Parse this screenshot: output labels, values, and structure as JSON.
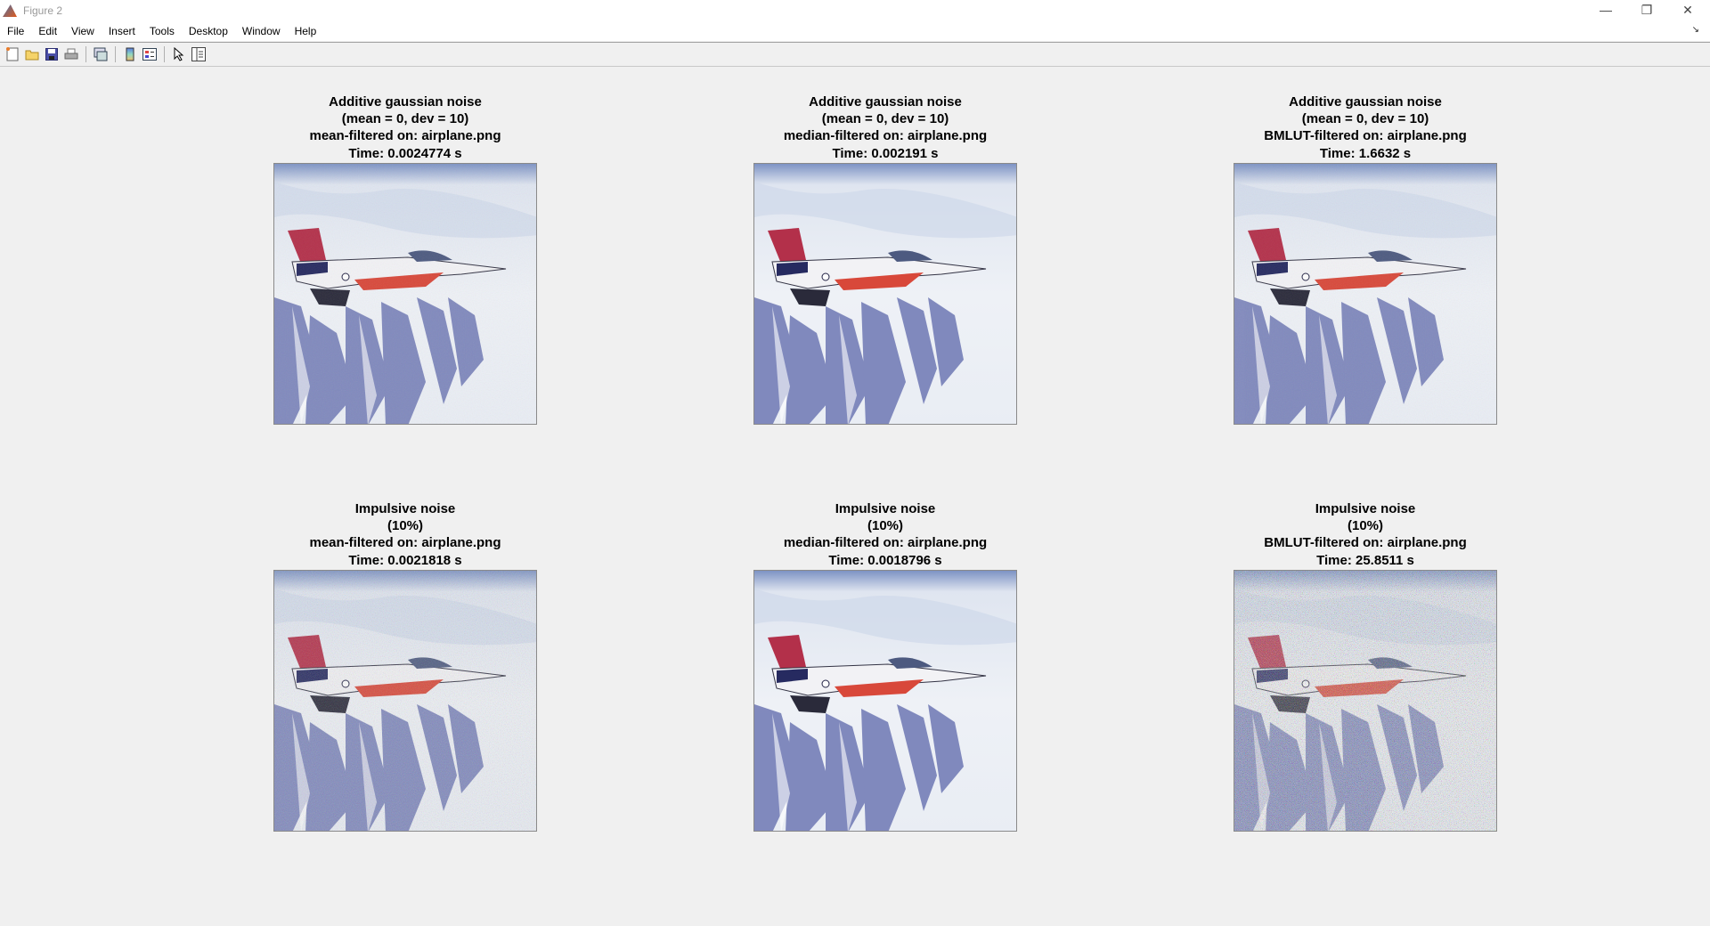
{
  "window": {
    "title": "Figure 2",
    "minimize": "—",
    "restore": "❐",
    "close": "✕",
    "dock": "↘"
  },
  "menu": [
    "File",
    "Edit",
    "View",
    "Insert",
    "Tools",
    "Desktop",
    "Window",
    "Help"
  ],
  "toolbar": [
    "new-figure",
    "open-file",
    "save",
    "print",
    "link-plot",
    "insert-colorbar",
    "insert-legend",
    "edit-plot",
    "property-inspector"
  ],
  "panels": [
    {
      "lines": [
        "Additive gaussian noise",
        "(mean = 0, dev = 10)",
        "mean-filtered on: airplane.png",
        "Time: 0.0024774 s"
      ],
      "noise": "light"
    },
    {
      "lines": [
        "Additive gaussian noise",
        "(mean = 0, dev = 10)",
        "median-filtered on: airplane.png",
        "Time: 0.002191 s"
      ],
      "noise": "none"
    },
    {
      "lines": [
        "Additive gaussian noise",
        "(mean = 0, dev = 10)",
        "BMLUT-filtered on: airplane.png",
        "Time: 1.6632 s"
      ],
      "noise": "light"
    },
    {
      "lines": [
        "Impulsive noise",
        "(10%)",
        "mean-filtered on: airplane.png",
        "Time: 0.0021818 s"
      ],
      "noise": "medium"
    },
    {
      "lines": [
        "Impulsive noise",
        "(10%)",
        "median-filtered on: airplane.png",
        "Time: 0.0018796 s"
      ],
      "noise": "none"
    },
    {
      "lines": [
        "Impulsive noise",
        "(10%)",
        "BMLUT-filtered on: airplane.png",
        "Time: 25.8511 s"
      ],
      "noise": "heavy"
    }
  ]
}
